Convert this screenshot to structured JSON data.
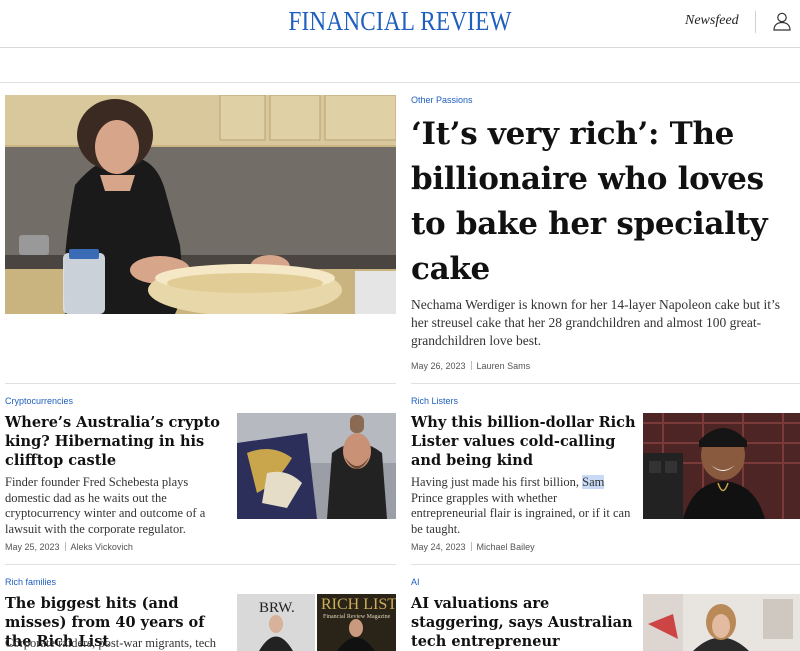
{
  "header": {
    "logo": "FINANCIAL REVIEW",
    "newsfeed_label": "Newsfeed"
  },
  "hero": {
    "category": "Other Passions",
    "title": "‘It’s very rich’: The billionaire who loves to bake her specialty cake",
    "description": "Nechama Werdiger is known for her 14-layer Napoleon cake but it’s her streusel cake that her 28 grandchildren and almost 100 great-grandchildren love best.",
    "date": "May 26, 2023",
    "author": "Lauren Sams"
  },
  "articles": [
    {
      "category": "Cryptocurrencies",
      "title": "Where’s Australia’s crypto king? Hibernating in his clifftop castle",
      "description": "Finder founder Fred Schebesta plays domestic dad as he waits out the cryptocurrency winter and outcome of a lawsuit with the corporate regulator.",
      "date": "May 25, 2023",
      "author": "Aleks Vickovich"
    },
    {
      "category": "Rich Listers",
      "title": "Why this billion-dollar Rich Lister values cold-calling and being kind",
      "description_before": "Having just made his first billion, ",
      "description_highlight": "Sam",
      "description_after": " Prince grapples with whether entrepreneurial flair is ingrained, or if it can be taught.",
      "date": "May 24, 2023",
      "author": "Michael Bailey"
    },
    {
      "category": "Rich families",
      "title": "The biggest hits (and misses) from 40 years of the Rich List",
      "description": "Corporate raiders, post-war migrants, tech",
      "cover_left": "BRW.",
      "cover_right_title": "RICH LIST",
      "cover_right_subtitle": "Financial Review Magazine"
    },
    {
      "category": "AI",
      "title": "AI valuations are staggering, says Australian tech entrepreneur"
    }
  ],
  "colors": {
    "brand_blue": "#1f5fbf",
    "highlight": "#c8daf5"
  }
}
